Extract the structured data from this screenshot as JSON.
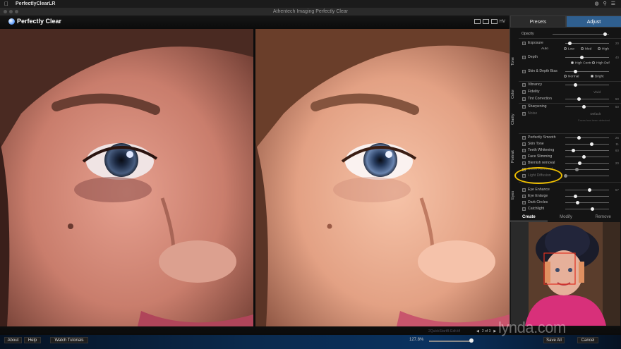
{
  "menubar": {
    "app_name": "PerfectlyClearLR"
  },
  "window": {
    "title": "Athentech Imaging Perfectly Clear"
  },
  "header": {
    "logo_text": "Perfectly Clear",
    "view_label": "HV"
  },
  "panel": {
    "tabs": [
      {
        "label": "Presets",
        "active": false
      },
      {
        "label": "Adjust",
        "active": true
      }
    ],
    "opacity": {
      "label": "Opacity",
      "value": 0.9
    },
    "tone": {
      "section": "Tone",
      "exposure": {
        "label": "Exposure",
        "value": "20",
        "level": 0.4,
        "sub_label": "Auto",
        "options": [
          "Low",
          "Med",
          "High"
        ]
      },
      "depth": {
        "label": "Depth",
        "value": "40",
        "level": 0.45,
        "options": [
          "High Contr",
          "High Def"
        ]
      },
      "skin_depth_bias": {
        "label": "Skin & Depth Bias",
        "level": 0.25,
        "options": [
          "Normal",
          "Bright"
        ]
      }
    },
    "color": {
      "section": "Color",
      "vibrancy": {
        "label": "Vibrancy",
        "value": "",
        "level": 0.3
      },
      "fidelity": {
        "label": "Fidelity",
        "value": "Vivid",
        "level": 0
      },
      "tint_correction": {
        "label": "Tint Correction",
        "value": "50",
        "level": 0.35
      }
    },
    "clarity": {
      "section": "Clarity",
      "sharpening": {
        "label": "Sharpening",
        "value": "50",
        "level": 0.42
      },
      "noise": {
        "label": "Noise",
        "value": "Default",
        "hint": "Faces has been detected"
      }
    },
    "portrait": {
      "section": "Portrait",
      "items": [
        {
          "label": "Perfectly Smooth",
          "value": "26",
          "level": 0.3
        },
        {
          "label": "Skin Tone",
          "value": "11",
          "level": 0.6
        },
        {
          "label": "Teeth Whitening",
          "value": "60",
          "level": 0.18
        },
        {
          "label": "Face Slimming",
          "value": "",
          "level": 0.42
        },
        {
          "label": "Blemish removal",
          "value": "20",
          "level": 0.33
        },
        {
          "label": "Shine Removal",
          "value": "",
          "level": 0.25
        },
        {
          "label": "Light Diffusion",
          "value": "",
          "level": 0
        }
      ]
    },
    "eyes": {
      "section": "Eyes",
      "items": [
        {
          "label": "Eye Enhance",
          "value": "57",
          "level": 0.55
        },
        {
          "label": "Eye Enlarge",
          "value": "",
          "level": 0.22
        },
        {
          "label": "Dark Circles",
          "value": "",
          "level": 0.27
        },
        {
          "label": "Catchlight",
          "value": "",
          "level": 0.62
        }
      ]
    },
    "face_tabs": [
      {
        "label": "Create",
        "active": true
      },
      {
        "label": "Modify",
        "active": false
      },
      {
        "label": "Remove",
        "active": false
      }
    ]
  },
  "bottom": {
    "about": "About",
    "help": "Help",
    "tutorials": "Watch Tutorials",
    "filename": "2QuickStartB-Edit.tif",
    "pager": "2 of 3",
    "zoom": "127.8%",
    "zoom_level": 0.9,
    "save_all": "Save All",
    "cancel": "Cancel"
  },
  "watermark": "lynda.com",
  "colors": {
    "accent": "#2f5f8f",
    "annotation": "#f0c000",
    "brand_bar": "#0b2a4d"
  }
}
